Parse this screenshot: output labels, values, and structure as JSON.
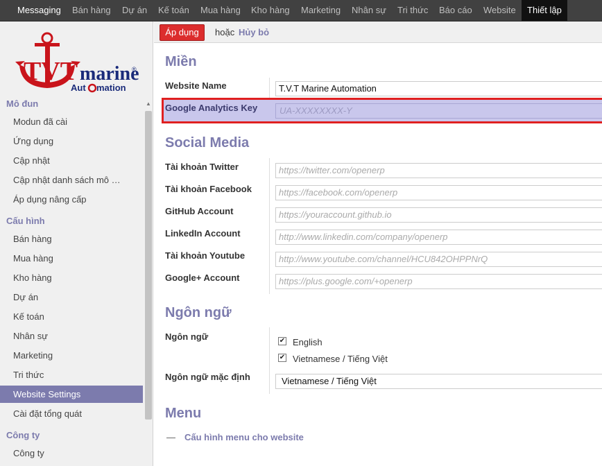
{
  "topnav": {
    "items": [
      "Messaging",
      "Bán hàng",
      "Dự án",
      "Kế toán",
      "Mua hàng",
      "Kho hàng",
      "Marketing",
      "Nhân sự",
      "Tri thức",
      "Báo cáo",
      "Website",
      "Thiết lập"
    ]
  },
  "logo": {
    "brand": "TVT",
    "word": "marine",
    "tagline_a": "Aut",
    "tagline_b": "mation",
    "registered": "®"
  },
  "sidebar": {
    "module_section": "Mô đun",
    "module_items": [
      "Modun đã cài",
      "Ứng dụng",
      "Cập nhật",
      "Cập nhật danh sách mô …",
      "Áp dụng nâng cấp"
    ],
    "config_section": "Cấu hình",
    "config_items": [
      "Bán hàng",
      "Mua hàng",
      "Kho hàng",
      "Dự án",
      "Kế toán",
      "Nhân sự",
      "Marketing",
      "Tri thức",
      "Website Settings",
      "Cài đặt tổng quát"
    ],
    "company_section": "Công ty",
    "company_items": [
      "Công ty"
    ],
    "selected": "Website Settings"
  },
  "actions": {
    "apply": "Áp dụng",
    "or": "hoặc",
    "cancel": "Hủy bỏ"
  },
  "domain": {
    "heading": "Miền",
    "website_name_label": "Website Name",
    "website_name_value": "T.V.T Marine Automation",
    "ga_label": "Google Analytics Key",
    "ga_placeholder": "UA-XXXXXXXX-Y"
  },
  "social": {
    "heading": "Social Media",
    "twitter_label": "Tài khoản Twitter",
    "twitter_placeholder": "https://twitter.com/openerp",
    "facebook_label": "Tài khoản Facebook",
    "facebook_placeholder": "https://facebook.com/openerp",
    "github_label": "GitHub Account",
    "github_placeholder": "https://youraccount.github.io",
    "linkedin_label": "LinkedIn Account",
    "linkedin_placeholder": "http://www.linkedin.com/company/openerp",
    "youtube_label": "Tài khoản Youtube",
    "youtube_placeholder": "http://www.youtube.com/channel/HCU842OHPPNrQ",
    "googleplus_label": "Google+ Account",
    "googleplus_placeholder": "https://plus.google.com/+openerp"
  },
  "language": {
    "heading": "Ngôn ngữ",
    "languages_label": "Ngôn ngữ",
    "lang_english": "English",
    "lang_vietnamese": "Vietnamese / Tiếng Việt",
    "default_label": "Ngôn ngữ mặc định",
    "default_value": "Vietnamese / Tiếng Việt",
    "checked_english": true,
    "checked_vietnamese": true
  },
  "menu": {
    "heading": "Menu",
    "dash": "—",
    "config_link": "Cấu hình menu cho website"
  },
  "colors": {
    "accent": "#7c7bad",
    "apply_button": "#dc2d2d",
    "highlight_border": "#e02020",
    "highlight_fill": "#c9c7ec",
    "topbar": "#414141"
  }
}
